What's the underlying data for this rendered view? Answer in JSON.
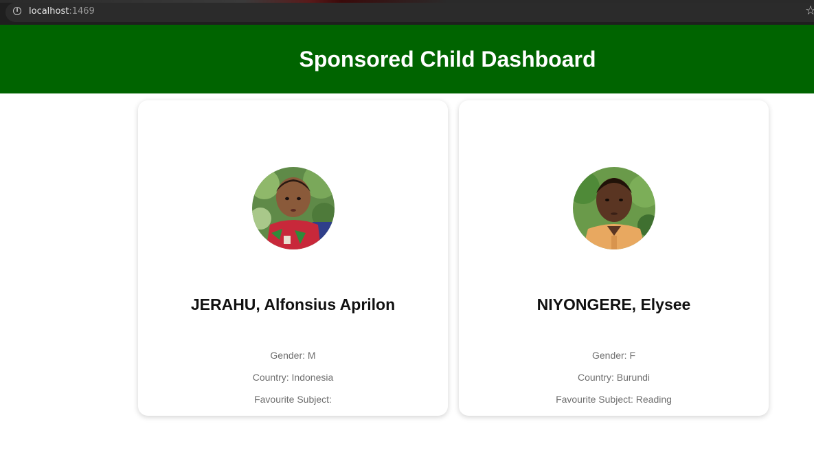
{
  "browser": {
    "url_host": "localhost",
    "url_port": ":1469"
  },
  "header": {
    "title": "Sponsored Child Dashboard"
  },
  "children": [
    {
      "name": "JERAHU, Alfonsius Aprilon",
      "gender": "Gender: M",
      "country": "Country: Indonesia",
      "favourite_subject": "Favourite Subject: "
    },
    {
      "name": "NIYONGERE, Elysee",
      "gender": "Gender: F",
      "country": "Country: Burundi",
      "favourite_subject": "Favourite Subject: Reading"
    }
  ],
  "colors": {
    "header_bg": "#006400",
    "header_text": "#ffffff",
    "name_text": "#111111",
    "detail_text": "#6e6e6e"
  }
}
